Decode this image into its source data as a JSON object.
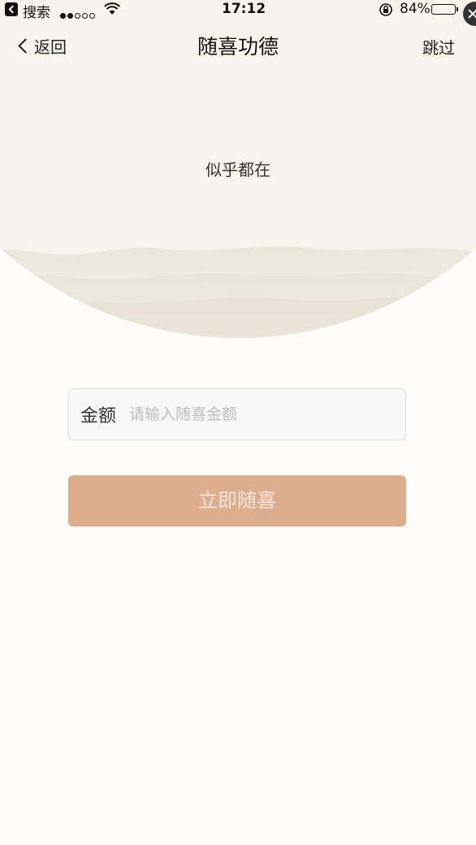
{
  "status_bar": {
    "back_app": "搜索",
    "time": "17:12",
    "battery": "84%",
    "battery_level": 0.84,
    "battery_color": "#4cd964"
  },
  "nav": {
    "back_label": "返回",
    "title": "随喜功德",
    "skip_label": "跳过"
  },
  "hero": {
    "subtitle": "似乎都在",
    "background_color": "#f8f4ec"
  },
  "form": {
    "amount_label": "金额",
    "amount_placeholder": "请输入随喜金额",
    "amount_value": "",
    "submit_label": "立即随喜",
    "submit_color": "#dcae8e"
  }
}
